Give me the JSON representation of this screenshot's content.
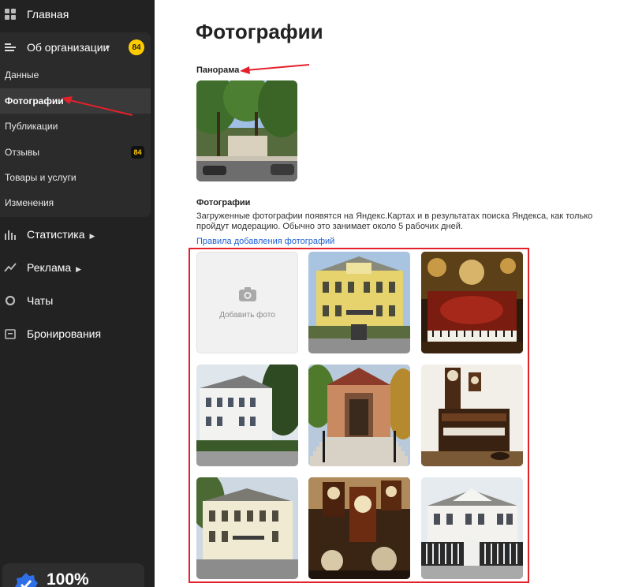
{
  "sidebar": {
    "home_label": "Главная",
    "org_label": "Об организации",
    "org_badge": "84",
    "sub_items": [
      {
        "label": "Данные"
      },
      {
        "label": "Фотографии"
      },
      {
        "label": "Публикации"
      },
      {
        "label": "Отзывы",
        "badge": "84"
      },
      {
        "label": "Товары и услуги"
      },
      {
        "label": "Изменения"
      }
    ],
    "stats_label": "Статистика",
    "ads_label": "Реклама",
    "chats_label": "Чаты",
    "booking_label": "Бронирования",
    "completeness": "100%"
  },
  "main": {
    "title": "Фотографии",
    "panorama_label": "Панорама",
    "photos_label": "Фотографии",
    "description": "Загруженные фотографии появятся на Яндекс.Картах и в результатах поиска Яндекса, как только пройдут модерацию. Обычно это занимает около 5 рабочих дней.",
    "rules_link": "Правила добавления фотографий",
    "add_photo_label": "Добавить фото"
  },
  "colors": {
    "sidebar_bg": "#222222",
    "badge_yellow": "#ffcc00",
    "link_blue": "#1a5fd4",
    "highlight_red": "#e4202b"
  }
}
